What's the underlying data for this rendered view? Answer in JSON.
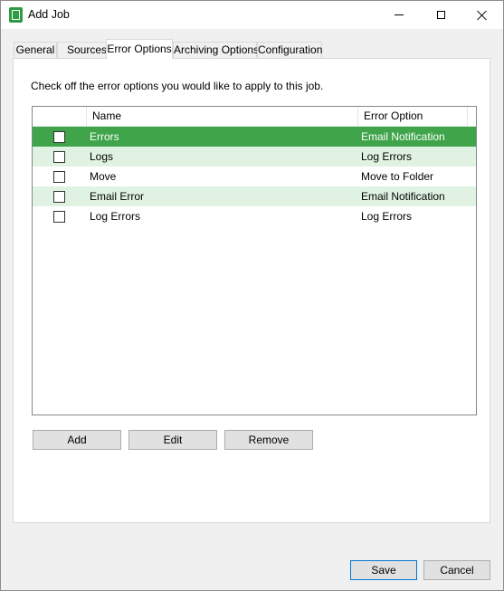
{
  "window": {
    "title": "Add Job",
    "icon": "app-job-icon",
    "controls": [
      "minimize",
      "maximize",
      "close"
    ]
  },
  "tabs": [
    {
      "label": "General",
      "active": false
    },
    {
      "label": "Sources",
      "active": false
    },
    {
      "label": "Error Options",
      "active": true
    },
    {
      "label": "Archiving Options",
      "active": false
    },
    {
      "label": "Configuration",
      "active": false
    }
  ],
  "panel": {
    "instructions": "Check off the error options you would like to apply to this job."
  },
  "table": {
    "columns": [
      "",
      "Name",
      "Error Option"
    ],
    "rows": [
      {
        "checked": false,
        "name": "Errors",
        "option": "Email Notification",
        "selected": true
      },
      {
        "checked": false,
        "name": "Logs",
        "option": "Log Errors",
        "selected": false
      },
      {
        "checked": false,
        "name": "Move",
        "option": "Move to Folder",
        "selected": false
      },
      {
        "checked": false,
        "name": "Email Error",
        "option": "Email Notification",
        "selected": false
      },
      {
        "checked": false,
        "name": "Log Errors",
        "option": "Log Errors",
        "selected": false
      }
    ]
  },
  "buttons": {
    "add": "Add",
    "edit": "Edit",
    "remove": "Remove",
    "save": "Save",
    "cancel": "Cancel"
  },
  "colors": {
    "selected_row": "#3fa44a",
    "alt_row": "#e0f3e2",
    "default_button_border": "#0078d7"
  }
}
